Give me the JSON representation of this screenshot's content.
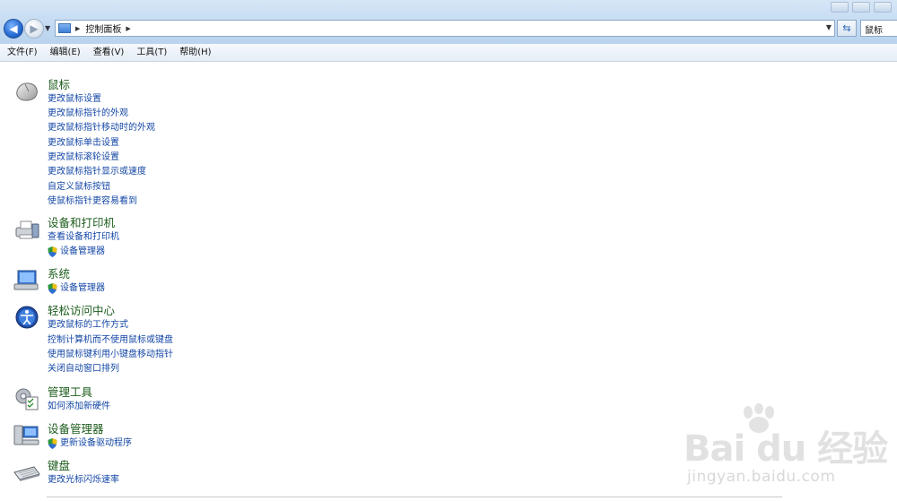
{
  "address": {
    "breadcrumb": "控制面板",
    "search_value": "鼠标"
  },
  "menu": [
    "文件(F)",
    "编辑(E)",
    "查看(V)",
    "工具(T)",
    "帮助(H)"
  ],
  "groups": [
    {
      "title": "鼠标",
      "icon": "mouse-icon",
      "tasks": [
        {
          "label": "更改鼠标设置",
          "shield": false
        },
        {
          "label": "更改鼠标指针的外观",
          "shield": false
        },
        {
          "label": "更改鼠标指针移动时的外观",
          "shield": false
        },
        {
          "label": "更改鼠标单击设置",
          "shield": false
        },
        {
          "label": "更改鼠标滚轮设置",
          "shield": false
        },
        {
          "label": "更改鼠标指针显示或速度",
          "shield": false
        },
        {
          "label": "自定义鼠标按钮",
          "shield": false
        },
        {
          "label": "使鼠标指针更容易看到",
          "shield": false
        }
      ]
    },
    {
      "title": "设备和打印机",
      "icon": "printer-icon",
      "tasks": [
        {
          "label": "查看设备和打印机",
          "shield": false
        },
        {
          "label": "设备管理器",
          "shield": true
        }
      ]
    },
    {
      "title": "系统",
      "icon": "system-icon",
      "tasks": [
        {
          "label": "设备管理器",
          "shield": true
        }
      ]
    },
    {
      "title": "轻松访问中心",
      "icon": "ease-of-access-icon",
      "tasks": [
        {
          "label": "更改鼠标的工作方式",
          "shield": false
        },
        {
          "label": "控制计算机而不使用鼠标或键盘",
          "shield": false
        },
        {
          "label": "使用鼠标键利用小键盘移动指针",
          "shield": false
        },
        {
          "label": "关闭自动窗口排列",
          "shield": false
        }
      ]
    },
    {
      "title": "管理工具",
      "icon": "admin-tools-icon",
      "tasks": [
        {
          "label": "如何添加新硬件",
          "shield": false
        }
      ]
    },
    {
      "title": "设备管理器",
      "icon": "device-manager-icon",
      "tasks": [
        {
          "label": "更新设备驱动程序",
          "shield": true
        }
      ]
    },
    {
      "title": "键盘",
      "icon": "keyboard-icon",
      "tasks": [
        {
          "label": "更改光标闪烁速率",
          "shield": false
        }
      ]
    }
  ],
  "watermark": {
    "logo": "Bai du 经验",
    "url": "jingyan.baidu.com"
  },
  "colors": {
    "group_title": "#1e5d1e",
    "task_link": "#1447a6",
    "titlebar": "#c4dbf2"
  }
}
